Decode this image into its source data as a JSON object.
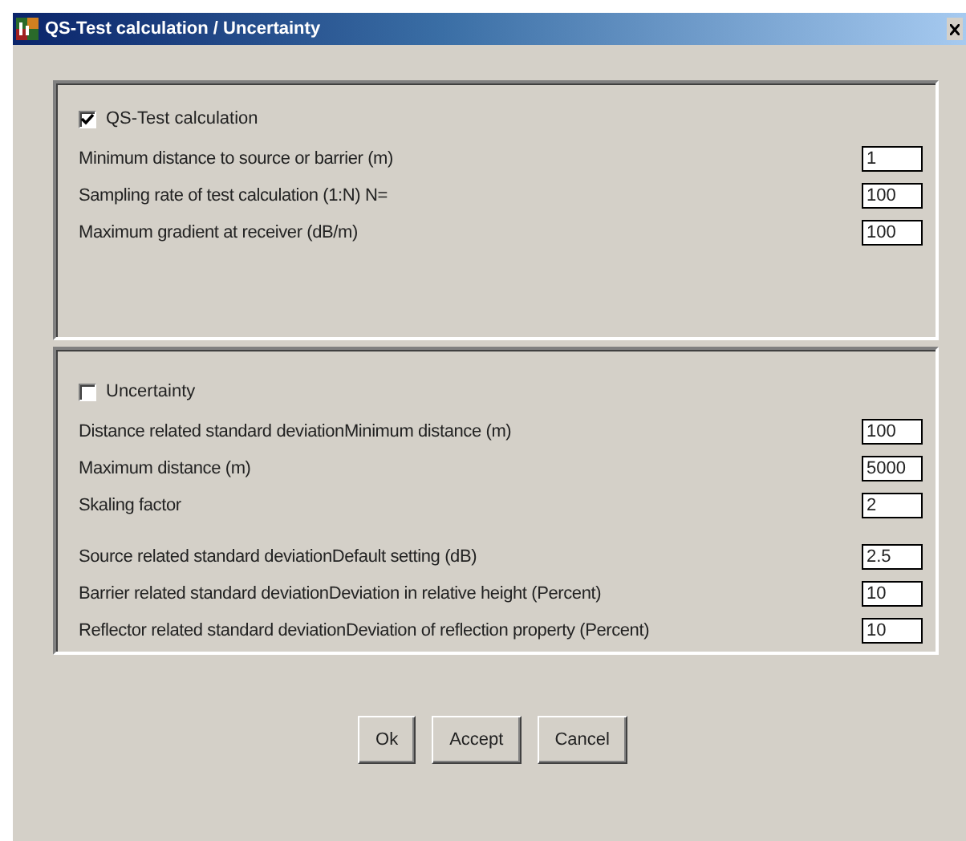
{
  "window": {
    "title": "QS-Test calculation / Uncertainty"
  },
  "groups": [
    {
      "checkbox": {
        "label": "QS-Test calculation",
        "checked": true
      },
      "blocks": [
        [
          {
            "label": "Minimum distance to source or barrier (m)",
            "value": "1"
          },
          {
            "label": "Sampling rate of test calculation (1:N)  N=",
            "value": "100"
          },
          {
            "label": "Maximum gradient at receiver (dB/m)",
            "value": "100"
          }
        ]
      ]
    },
    {
      "checkbox": {
        "label": "Uncertainty",
        "checked": false
      },
      "blocks": [
        [
          {
            "label": "Distance related standard deviationMinimum distance (m)",
            "value": "100"
          },
          {
            "label": "Maximum distance (m)",
            "value": "5000"
          },
          {
            "label": "Skaling factor",
            "value": "2"
          }
        ],
        [
          {
            "label": "Source related standard deviationDefault setting (dB)",
            "value": "2.5"
          },
          {
            "label": "Barrier related standard deviationDeviation in relative height (Percent)",
            "value": "10"
          },
          {
            "label": "Reflector related standard deviationDeviation of reflection property (Percent)",
            "value": "10"
          }
        ]
      ]
    }
  ],
  "buttons": [
    "Ok",
    "Accept",
    "Cancel"
  ]
}
